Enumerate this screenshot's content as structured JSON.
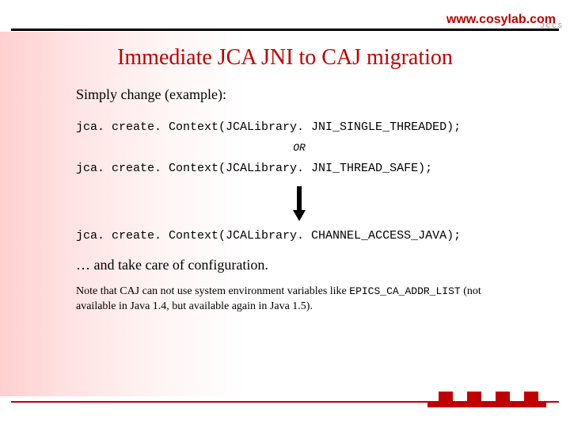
{
  "header": {
    "url": "www.cosylab.com",
    "faint": "JCCS"
  },
  "title": "Immediate JCA JNI to CAJ migration",
  "intro": "Simply change (example):",
  "code1": "jca. create. Context(JCALibrary. JNI_SINGLE_THREADED);",
  "or": "OR",
  "code2": "jca. create. Context(JCALibrary. JNI_THREAD_SAFE);",
  "code3": "jca. create. Context(JCALibrary. CHANNEL_ACCESS_JAVA);",
  "outro": "… and take care of configuration.",
  "note_pre": "Note that CAJ can not use system environment variables like ",
  "note_var": "EPICS_CA_ADDR_LIST",
  "note_post": " (not available in Java 1.4, but available again in Java 1.5)."
}
